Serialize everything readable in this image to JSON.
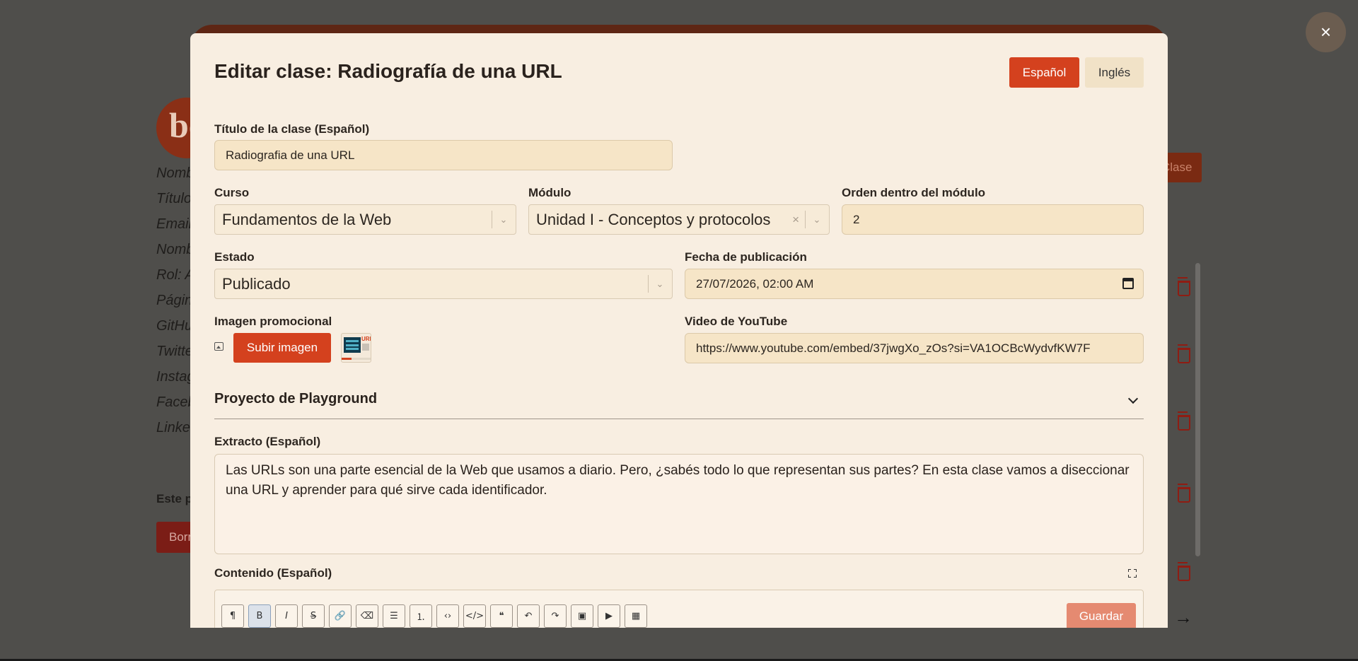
{
  "background": {
    "avatar_text": "bo",
    "profile_fields": [
      "Nombre",
      "Título",
      "Email",
      "Nombre",
      "Rol: Admin",
      "Página",
      "GitHub",
      "Twitter",
      "Instagram",
      "Facebook",
      "LinkedIn"
    ],
    "notice_text": "Este perfil",
    "delete_label": "Borrar",
    "add_class_label": "Clase",
    "next_arrow": "→"
  },
  "close_label": "×",
  "modal": {
    "title": "Editar clase: Radiografía de una URL",
    "languages": {
      "spanish": "Español",
      "english": "Inglés"
    },
    "fields": {
      "title_label": "Título de la clase (Español)",
      "title_value": "Radiografia de una URL",
      "course_label": "Curso",
      "course_value": "Fundamentos de la Web",
      "module_label": "Módulo",
      "module_value": "Unidad I - Conceptos y protocolos",
      "order_label": "Orden dentro del módulo",
      "order_value": "2",
      "status_label": "Estado",
      "status_value": "Publicado",
      "date_label": "Fecha de publicación",
      "date_value": "27/07/2026, 02:00 AM",
      "image_label": "Imagen promocional",
      "upload_label": "Subir imagen",
      "thumb_text": "URL",
      "video_label": "Video de YouTube",
      "video_value": "https://www.youtube.com/embed/37jwgXo_zOs?si=VA1OCBcWydvfKW7F"
    },
    "playground": {
      "title": "Proyecto de Playground"
    },
    "excerpt": {
      "label": "Extracto (Español)",
      "text": "Las URLs son una parte esencial de la Web que usamos a diario. Pero, ¿sabés todo lo que representan sus partes? En esta clase vamos a diseccionar una URL y aprender para qué sirve cada identificador."
    },
    "content": {
      "label": "Contenido (Español)",
      "toolbar": [
        {
          "name": "paragraph-icon",
          "glyph": "¶"
        },
        {
          "name": "bold-icon",
          "glyph": "B"
        },
        {
          "name": "italic-icon",
          "glyph": "I"
        },
        {
          "name": "strikethrough-icon",
          "glyph": "S"
        },
        {
          "name": "link-icon",
          "glyph": "🔗"
        },
        {
          "name": "eraser-icon",
          "glyph": "⌫"
        },
        {
          "name": "bullet-list-icon",
          "glyph": "☰"
        },
        {
          "name": "ordered-list-icon",
          "glyph": "⒈"
        },
        {
          "name": "code-icon",
          "glyph": "‹›"
        },
        {
          "name": "code-block-icon",
          "glyph": "</>"
        },
        {
          "name": "quote-icon",
          "glyph": "❝"
        },
        {
          "name": "undo-icon",
          "glyph": "↶"
        },
        {
          "name": "redo-icon",
          "glyph": "↷"
        },
        {
          "name": "image-icon",
          "glyph": "▣"
        },
        {
          "name": "youtube-icon",
          "glyph": "▶"
        },
        {
          "name": "table-icon",
          "glyph": "▦"
        }
      ],
      "save_label": "Guardar"
    }
  },
  "colors": {
    "accent": "#d4411e",
    "modal_bg": "#f8eee1",
    "overlay": "#4f4e4b"
  }
}
